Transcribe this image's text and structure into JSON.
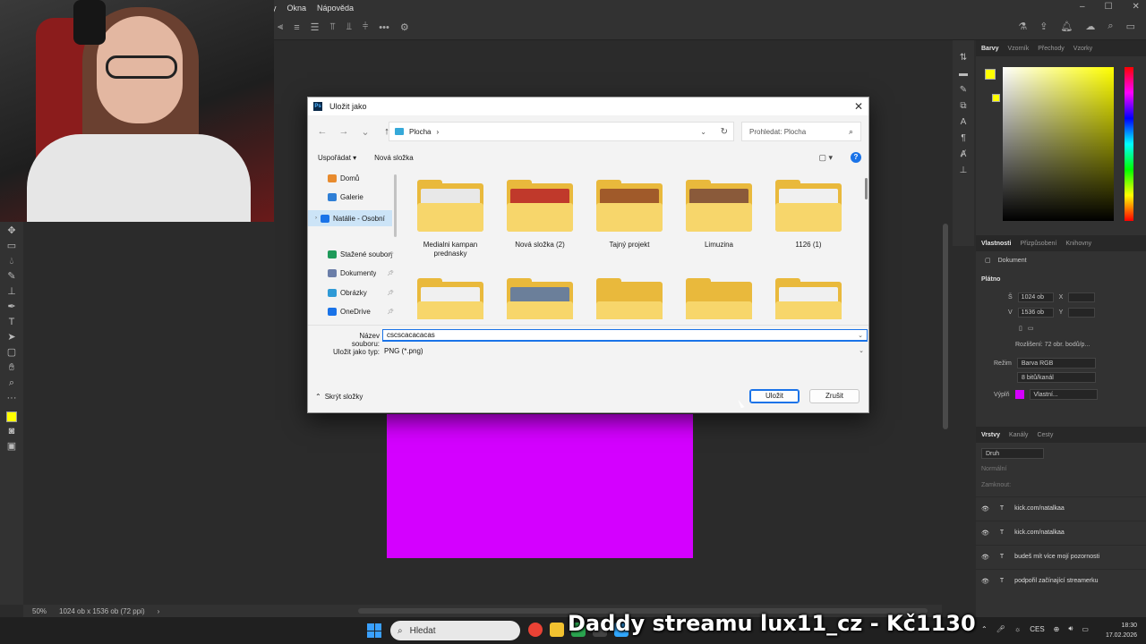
{
  "menubar": {
    "items": [
      "ly",
      "Okna",
      "Nápověda"
    ]
  },
  "statusbar": {
    "zoom": "50%",
    "doc_info": "1024 ob x 1536 ob (72 ppi)"
  },
  "right_panel": {
    "color_tabs": [
      "Barvy",
      "Vzorník",
      "Přechody",
      "Vzorky"
    ],
    "props_tabs": [
      "Vlastnosti",
      "Přizpůsobení",
      "Knihovny"
    ],
    "doc_label": "Dokument",
    "canvas_section": "Plátno",
    "width_label": "Š",
    "width_value": "1024 ob",
    "height_label": "V",
    "height_value": "1536 ob",
    "x_label": "X",
    "y_label": "Y",
    "resolution": "Rozlišení: 72 obr. bodů/p...",
    "mode_label": "Režim",
    "mode_value": "Barva RGB",
    "depth_value": "8 bitů/kanál",
    "fill_label": "Výplň",
    "fill_value": "Vlastní...",
    "fill_color": "#d400ff",
    "layers_tabs": [
      "Vrstvy",
      "Kanály",
      "Cesty"
    ],
    "kind_label": "Druh",
    "blend_label": "Normální",
    "lock_label": "Zamknout:",
    "layers": [
      "kick.com/natalkaa",
      "kick.com/natalkaa",
      "budeš mít více mojí pozornosti",
      "podpořil začínající streamerku"
    ]
  },
  "dialog": {
    "title": "Uložit jako",
    "path": [
      "Plocha",
      "›"
    ],
    "search_placeholder": "Prohledat: Plocha",
    "organize_label": "Uspořádat ▾",
    "new_folder_label": "Nová složka",
    "nav_items": [
      {
        "label": "Domů",
        "color": "#e88b2e"
      },
      {
        "label": "Galerie",
        "color": "#2f7fd6"
      },
      {
        "label": "Natálie - Osobní",
        "color": "#1a73e8"
      },
      {
        "label": "Stažené soubory",
        "color": "#1f9a5a"
      },
      {
        "label": "Dokumenty",
        "color": "#6b7ea8"
      },
      {
        "label": "Obrázky",
        "color": "#2f9ad6"
      },
      {
        "label": "OneDrive",
        "color": "#1a73e8"
      }
    ],
    "files": [
      {
        "name": "Medialni kampan prednasky",
        "thumb": "#e8e8e8"
      },
      {
        "name": "Nová složka (2)",
        "thumb": "#c0392b"
      },
      {
        "name": "Tajný projekt",
        "thumb": "#a05a2a"
      },
      {
        "name": "Limuzina",
        "thumb": "#8a5a3a"
      },
      {
        "name": "1126 (1)",
        "thumb": "#f0f0f0"
      },
      {
        "name": "",
        "thumb": "#f0f0f0"
      },
      {
        "name": "",
        "thumb": "#6b7f9a"
      },
      {
        "name": "",
        "thumb": ""
      },
      {
        "name": "",
        "thumb": ""
      },
      {
        "name": "",
        "thumb": "#f0f0f0"
      }
    ],
    "filename_label": "Název souboru:",
    "filename_value": "cscscacacacas",
    "filetype_label": "Uložit jako typ:",
    "filetype_value": "PNG (*.png)",
    "hide_folders_label": "Skrýt složky",
    "save_label": "Uložit",
    "cancel_label": "Zrušit"
  },
  "taskbar": {
    "search_placeholder": "Hledat",
    "overlay_text": "Daddy streamu lux11_cz - Kč1130",
    "lang": "CES",
    "time": "18:30",
    "date": "17.02.2026"
  },
  "colors": {
    "foreground": "#ffff00",
    "canvas_fill": "#d400ff",
    "accent": "#1a73e8"
  }
}
